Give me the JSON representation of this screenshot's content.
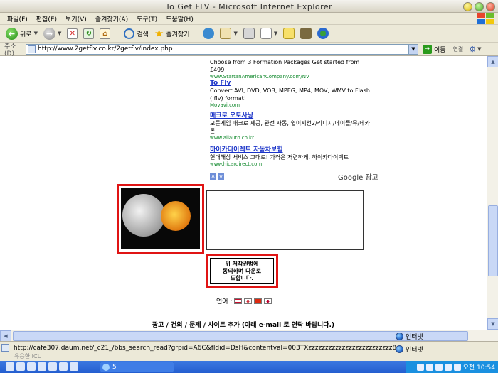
{
  "window": {
    "title": "To Get FLV - Microsoft Internet Explorer"
  },
  "menu": [
    "파일(F)",
    "편집(E)",
    "보기(V)",
    "즐겨찾기(A)",
    "도구(T)",
    "도움말(H)"
  ],
  "toolbar": {
    "back_label": "뒤로",
    "search_label": "검색",
    "favorites_label": "즐겨찾기"
  },
  "address": {
    "label": "주소(D)",
    "url": "http://www.2getflv.co.kr/2getflv/index.php",
    "go_label": "이동",
    "links_label": "연결"
  },
  "ads": [
    {
      "title": "",
      "desc": "Choose from 3 Formation Packages Get started from £499",
      "url": "www.StartanAmericanCompany.com/NV"
    },
    {
      "title": "To Flv",
      "desc": "Convert AVI, DVD, VOB, MPEG, MP4, MOV, WMV to Flash (.flv) format!",
      "url": "Movavi.com"
    },
    {
      "title": "매크로 오토사냥",
      "desc": "모든게임 매크로 제공, 완전 자동, 쉽이지천2/리니지/메이플/뮤/데카론",
      "url": "www.allauto.co.kr"
    },
    {
      "title": "하이카다이렉트 자동차보험",
      "desc": "현대해상 서비스 그대로! 가격은 저렴하게. 하이카다이렉트",
      "url": "www.hicardirect.com"
    }
  ],
  "google_label": "Google 광고",
  "download_button": {
    "line1": "위 저작권법에",
    "line2": "동의하며 다운로",
    "line3": "드합니다."
  },
  "language_label": "언어 :",
  "footer_note": "광고 / 건의 / 문제 / 사이트 추가 (아래 e-mail 로 연락 바랍니다.)",
  "zone_label": "인터넷",
  "status": {
    "url": "http://cafe307.daum.net/_c21_/bbs_search_read?grpid=A6C&fldid=DsH&contentval=003TXzzzzzzzzzzzzzzzzzzzzzzzzz8",
    "behind_text": "유용한 ICL"
  },
  "taskbar": {
    "task_label": "5",
    "clock": "오전 10:54"
  }
}
